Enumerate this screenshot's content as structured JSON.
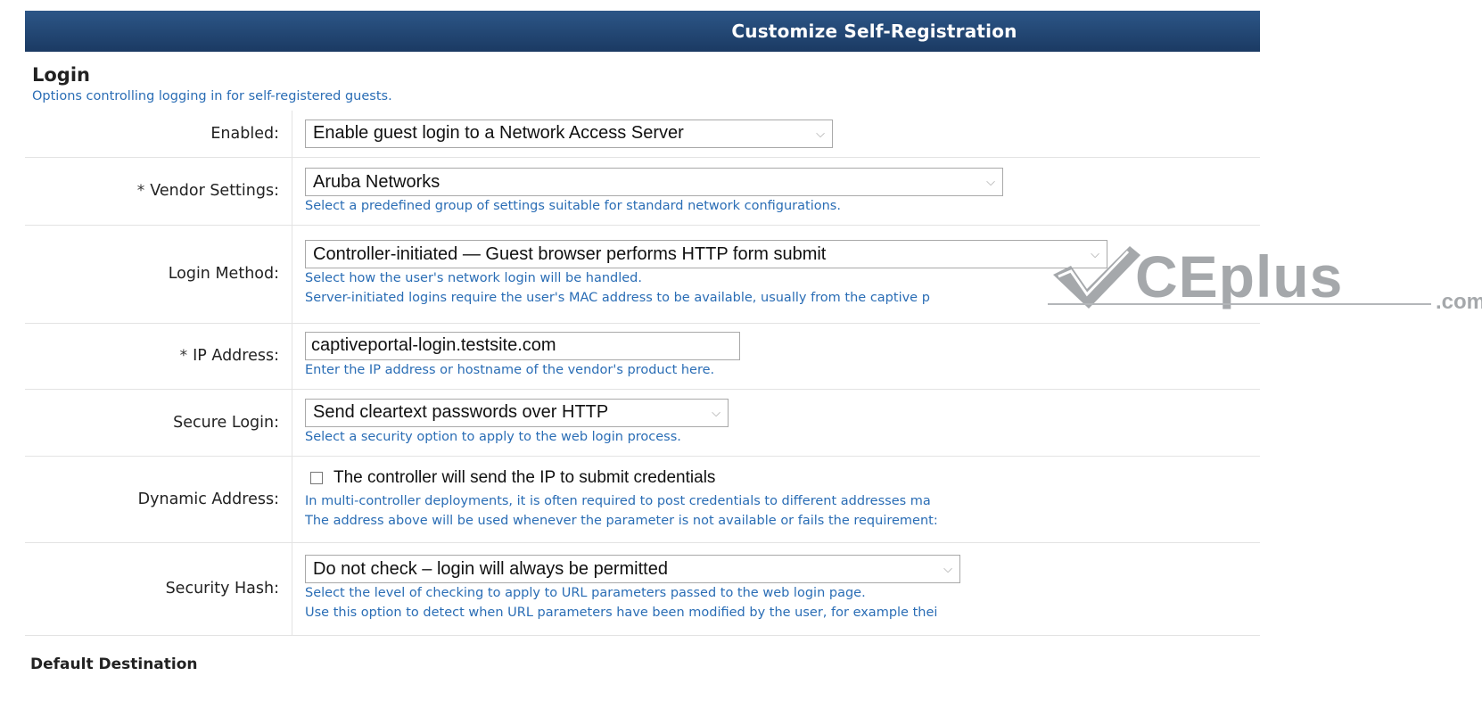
{
  "header": {
    "title": "Customize Self-Registration"
  },
  "section": {
    "title": "Login",
    "description": "Options controlling logging in for self-registered guests."
  },
  "rows": {
    "enabled": {
      "label": "Enabled:",
      "value": "Enable guest login to a Network Access Server"
    },
    "vendor": {
      "required": "*",
      "label": "Vendor Settings:",
      "value": "Aruba Networks",
      "hint": "Select a predefined group of settings suitable for standard network configurations."
    },
    "login_method": {
      "label": "Login Method:",
      "value": "Controller-initiated — Guest browser performs HTTP form submit",
      "hint1": "Select how the user's network login will be handled.",
      "hint2": "Server-initiated logins require the user's MAC address to be available, usually from the captive p"
    },
    "ip_address": {
      "required": "*",
      "label": "IP Address:",
      "value": "captiveportal-login.testsite.com",
      "hint": "Enter the IP address or hostname of the vendor's product here."
    },
    "secure_login": {
      "label": "Secure Login:",
      "value": "Send cleartext passwords over HTTP",
      "hint": "Select a security option to apply to the web login process."
    },
    "dynamic_address": {
      "label": "Dynamic Address:",
      "checkbox_label": "The controller will send the IP to submit credentials",
      "checked": false,
      "hint1": "In multi-controller deployments, it is often required to post credentials to different addresses ma",
      "hint2": "The address above will be used whenever the parameter is not available or fails the requirement:"
    },
    "security_hash": {
      "label": "Security Hash:",
      "value": "Do not check – login will always be permitted",
      "hint1": "Select the level of checking to apply to URL parameters passed to the web login page.",
      "hint2": "Use this option to detect when URL parameters have been modified by the user, for example thei"
    }
  },
  "next_section": {
    "title": "Default Destination"
  },
  "watermark": {
    "text": "CEplus",
    "suffix": ".com"
  },
  "colors": {
    "header_bg": "#1f4170",
    "hint_text": "#2a6db5",
    "watermark": "#a5a8ab"
  }
}
